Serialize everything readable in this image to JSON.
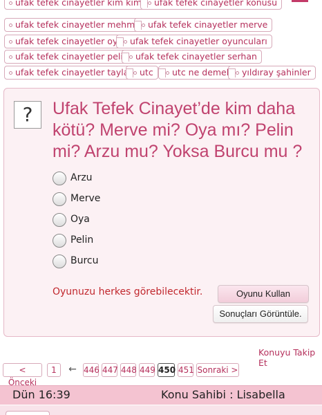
{
  "tags": [
    "ufak tefek cinayetler kim kimdir",
    "ufak tefek cinayetler konusu",
    "ufak tefek cinayetler mehmet",
    "ufak tefek cinayetler merve",
    "ufak tefek cinayetler oya",
    "ufak tefek cinayetler oyuncuları",
    "ufak tefek cinayetler pelin",
    "ufak tefek cinayetler serhan",
    "ufak tefek cinayetler taylan",
    "utc",
    "utc ne demek",
    "yıldıray şahinler"
  ],
  "poll": {
    "icon": "?",
    "question": "Ufak Tefek Cinayet’de kim daha kötü? Merve mi? Oya mı? Pelin mi? Arzu mu? Yoksa Burcu mu ?",
    "options": [
      "Arzu",
      "Merve",
      "Oya",
      "Pelin",
      "Burcu"
    ],
    "notice": "Oyunuzu herkes görebilecektir.",
    "use_vote_label": "Oyunu Kullan",
    "view_results_label": "Sonuçları Görüntüle."
  },
  "follow_label": "Konuyu Takip Et",
  "pagination": {
    "prev_label": "< Önceki",
    "first": "1",
    "arrow": "←",
    "pages": [
      "446",
      "447",
      "448",
      "449",
      "450",
      "451"
    ],
    "current": "450",
    "next_label": "Sonraki >"
  },
  "footer": {
    "date": "Dün 16:39",
    "author": "Konu Sahibi : Lisabella"
  },
  "colors": {
    "accent": "#c0436f",
    "tag_text": "#b5305c",
    "notice_red": "#c1272d",
    "footer_bg": "#f4c3d1"
  }
}
